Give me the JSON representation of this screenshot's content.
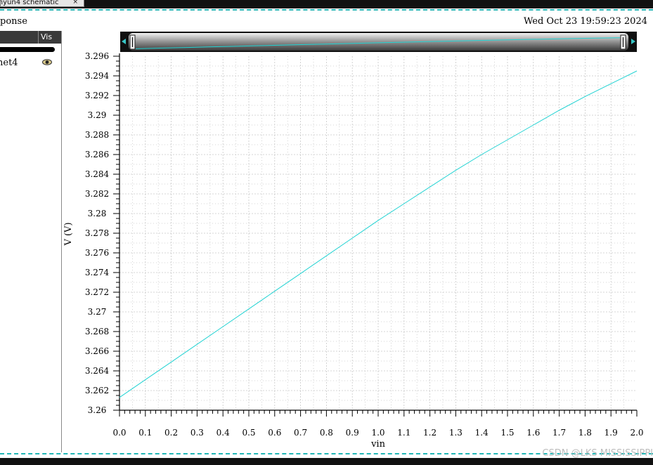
{
  "window": {
    "tab_label": "inyun4 schematic",
    "tab_close": "×"
  },
  "header": {
    "title": "ponse",
    "date": "Wed Oct 23 19:59:23 2024"
  },
  "panel": {
    "column_name": "",
    "column_vis": "Vis",
    "items": [
      {
        "label": "net4",
        "visible_icon": "eye-icon"
      }
    ]
  },
  "watermark": "CSDN @LKS MISSISSIPPI",
  "colors": {
    "trace": "#22d3d3",
    "dash": "#22b7b7",
    "grid": "#c8c8c8"
  },
  "chart_data": {
    "type": "line",
    "title": "",
    "xlabel": "vin",
    "ylabel": "V (V)",
    "xlim": [
      0.0,
      2.0
    ],
    "ylim": [
      3.26,
      3.296
    ],
    "x_ticks": [
      "0.0",
      "0.1",
      "0.2",
      "0.3",
      "0.4",
      "0.5",
      "0.6",
      "0.7",
      "0.8",
      "0.9",
      "1.0",
      "1.1",
      "1.2",
      "1.3",
      "1.4",
      "1.5",
      "1.6",
      "1.7",
      "1.8",
      "1.9",
      "2.0"
    ],
    "y_ticks": [
      "3.26",
      "3.262",
      "3.264",
      "3.266",
      "3.268",
      "3.27",
      "3.272",
      "3.274",
      "3.276",
      "3.278",
      "3.28",
      "3.282",
      "3.284",
      "3.286",
      "3.288",
      "3.29",
      "3.292",
      "3.294",
      "3.296"
    ],
    "grid": true,
    "series": [
      {
        "name": "net4",
        "x": [
          0.0,
          0.1,
          0.2,
          0.3,
          0.4,
          0.5,
          0.6,
          0.7,
          0.8,
          0.9,
          1.0,
          1.1,
          1.2,
          1.3,
          1.4,
          1.5,
          1.6,
          1.7,
          1.8,
          1.9,
          2.0
        ],
        "y": [
          3.2613,
          3.2631,
          3.2649,
          3.2667,
          3.2685,
          3.2703,
          3.2721,
          3.2739,
          3.2757,
          3.2775,
          3.2793,
          3.281,
          3.2827,
          3.2844,
          3.286,
          3.2875,
          3.289,
          3.2905,
          3.2919,
          3.2932,
          3.2945
        ]
      }
    ]
  }
}
